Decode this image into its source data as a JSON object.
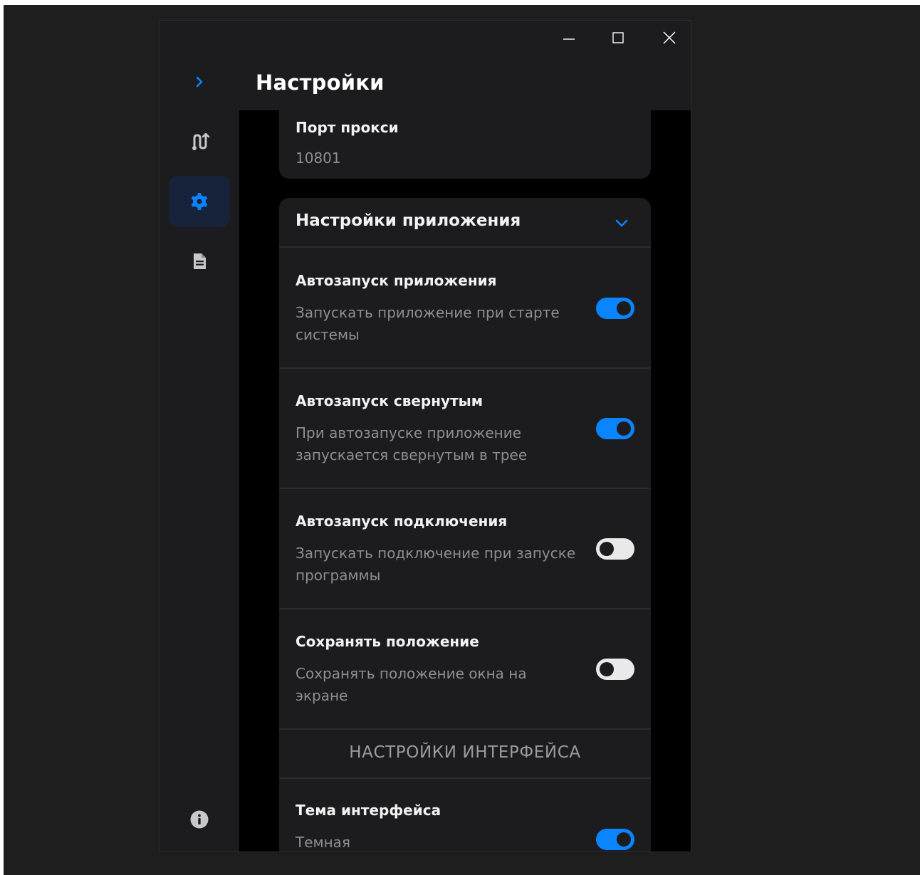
{
  "window": {
    "title": "Настройки",
    "controls": {
      "minimize": "minimize-icon",
      "maximize": "maximize-icon",
      "close": "close-icon"
    }
  },
  "sidebar": {
    "items": [
      {
        "icon": "chevron-right-icon",
        "name": "expand"
      },
      {
        "icon": "routes-icon",
        "name": "connections"
      },
      {
        "icon": "gear-icon",
        "name": "settings",
        "active": true
      },
      {
        "icon": "document-icon",
        "name": "logs"
      },
      {
        "icon": "info-icon",
        "name": "about"
      }
    ]
  },
  "proxy": {
    "label": "Порт прокси",
    "value": "10801"
  },
  "app_settings": {
    "title": "Настройки приложения",
    "rows": [
      {
        "title": "Автозапуск приложения",
        "description": "Запускать приложение при старте системы",
        "enabled": true
      },
      {
        "title": "Автозапуск свернутым",
        "description": "При автозапуске приложение запускается свернутым в трее",
        "enabled": true
      },
      {
        "title": "Автозапуск подключения",
        "description": "Запускать подключение при запуске программы",
        "enabled": false
      },
      {
        "title": "Сохранять положение",
        "description": "Сохранять положение окна на экране",
        "enabled": false
      }
    ]
  },
  "interface": {
    "header": "НАСТРОЙКИ ИНТЕРФЕЙСА",
    "theme": {
      "title": "Тема интерфейса",
      "value": "Темная",
      "enabled": true
    }
  },
  "colors": {
    "accent": "#0a84ff",
    "background": "#000000",
    "card": "#1c1c1e",
    "active_nav": "#16233a"
  }
}
